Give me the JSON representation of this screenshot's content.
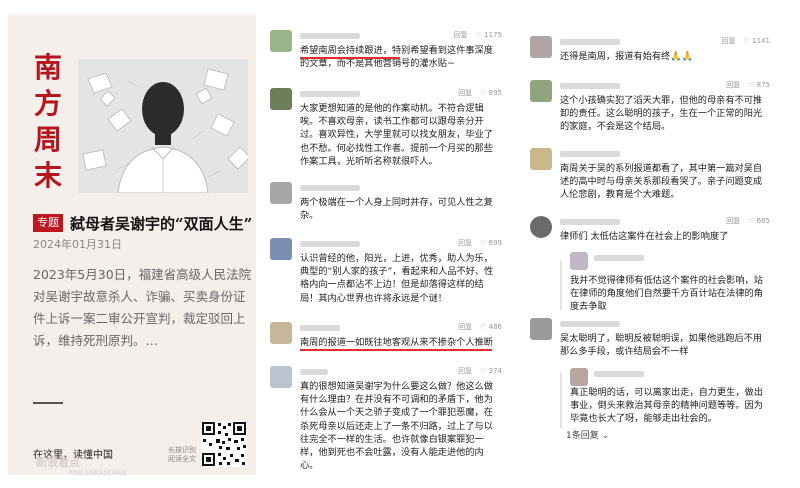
{
  "card": {
    "logo_chars": [
      "南",
      "方",
      "周",
      "末"
    ],
    "tag": "专题",
    "title": "弑母者吴谢宇的“双面人生”",
    "date": "2024年01月31日",
    "summary": "2023年5月30日，福建省高级人民法院对吴谢宇故意杀人、诈骗、买卖身份证件上诉一案二审公开宣判，裁定驳回上诉，维持死刑原判。…",
    "footer_link": "在这里，读懂中国",
    "qr_hint": "长按识别阅读全文",
    "watermark": "新浪看点",
    "watermark_sub": "XINLANKANDIAN",
    "accent_color": "#b5161e"
  },
  "reply_label": "回复",
  "comments_left": [
    {
      "likes": "1175",
      "text": "希望南周会持续跟进，特别希望看到这件事深度的文章，而不是其他营销号的灌水贴~"
    },
    {
      "likes": "895",
      "text": "大家更想知道的是他的作案动机。不符合逻辑唉。不喜欢母亲，读书工作都可以跟母亲分开过。喜欢异性，大学里就可以找女朋友，毕业了也不愁。何必找性工作者。提前一个月买的那些作案工具，光听听名称就很吓人。"
    },
    {
      "likes": "",
      "text": "两个极端在一个人身上同时并存，可见人性之复杂。"
    },
    {
      "likes": "699",
      "text": "认识曾经的他，阳光，上进，优秀，助人为乐，典型的“别人家的孩子”，看起来和人品不好、性格内向一点都沾不上边！但是却落得这样的结局！其内心世界也许将永远是个谜！"
    },
    {
      "likes": "486",
      "text": "南周的报道一如既往地客观从来不掺杂个人推断"
    },
    {
      "likes": "374",
      "text": "真的很想知道吴谢宇为什么要这么做？他这么做有什么理由？在并没有不可调和的矛盾下，他为什么会从一个天之骄子变成了一个罪犯恶魔，在杀死母亲以后还走上了一条不归路，过上了与以往完全不一样的生活。也许就像白银案罪犯一样，他到死也不会吐露，没有人能走进他的内心。"
    }
  ],
  "comments_right": [
    {
      "likes": "1141",
      "text": "还得是南周，报道有始有终🙏🙏"
    },
    {
      "likes": "875",
      "text": "这个小孩确实犯了滔天大罪，但他的母亲有不可推卸的责任。这么聪明的孩子，生在一个正常的阳光的家庭，不会是这个结局。"
    },
    {
      "likes": "",
      "text": "南周关于吴的系列报道都看了，其中第一篇对吴自述的高中时与母亲关系那段看哭了。亲子问题变成人伦悲剧，教育是个大难题。"
    },
    {
      "likes": "665",
      "text": "律师们 太低估这案件在社会上的影响度了"
    },
    {
      "likes": "",
      "text": "我并不觉得律师有低估这个案件的社会影响，站在律师的角度他们自然要千方百计站在法律的角度去争取"
    },
    {
      "likes": "",
      "text": "吴太聪明了，聪明反被聪明误，如果他逃跑后不用那么多手段，或许结局会不一样"
    },
    {
      "likes": "",
      "text": "真正聪明的话，可以离家出走，自力更生，做出事业，倒头来救治其母亲的精神问题等等。因为毕竟也长大了呀，能够走出社会的。"
    }
  ],
  "more_replies": "1条回复 ⌄"
}
